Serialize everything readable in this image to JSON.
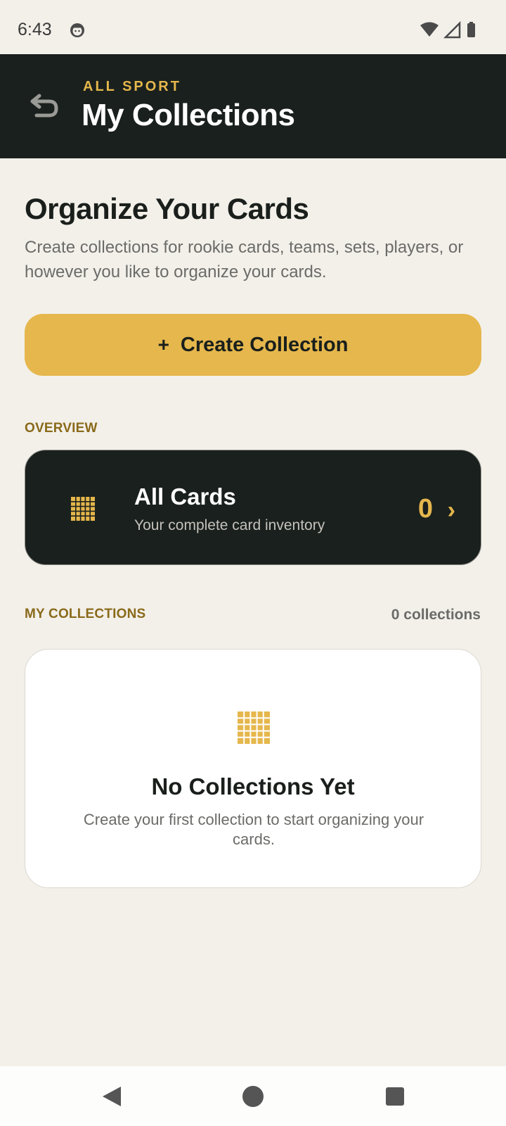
{
  "status_bar": {
    "time": "6:43",
    "icons": [
      "notification-face-icon",
      "wifi-icon",
      "signal-icon",
      "battery-icon"
    ]
  },
  "header": {
    "subtitle": "ALL SPORT",
    "title": "My Collections",
    "back_icon": "back-arrow-icon"
  },
  "intro": {
    "title": "Organize Your Cards",
    "description": "Create collections for rookie cards, teams, sets, players, or however you like to organize your cards."
  },
  "create_button": {
    "plus": "+",
    "label": "Create Collection"
  },
  "overview": {
    "label": "OVERVIEW",
    "all_cards": {
      "title": "All Cards",
      "description": "Your complete card inventory",
      "count": "0",
      "chevron": "›",
      "icon": "grid-icon"
    }
  },
  "my_collections": {
    "label": "MY COLLECTIONS",
    "count_text": "0 collections",
    "empty": {
      "icon": "grid-icon",
      "title": "No Collections Yet",
      "description": "Create your first collection to start organizing your cards."
    }
  },
  "colors": {
    "accent": "#e5b74c",
    "dark": "#1a201d",
    "background": "#f3f0ea",
    "section_label": "#8a6a1a"
  },
  "nav_bar": {
    "icons": [
      "back-triangle-icon",
      "home-circle-icon",
      "recents-square-icon"
    ]
  }
}
